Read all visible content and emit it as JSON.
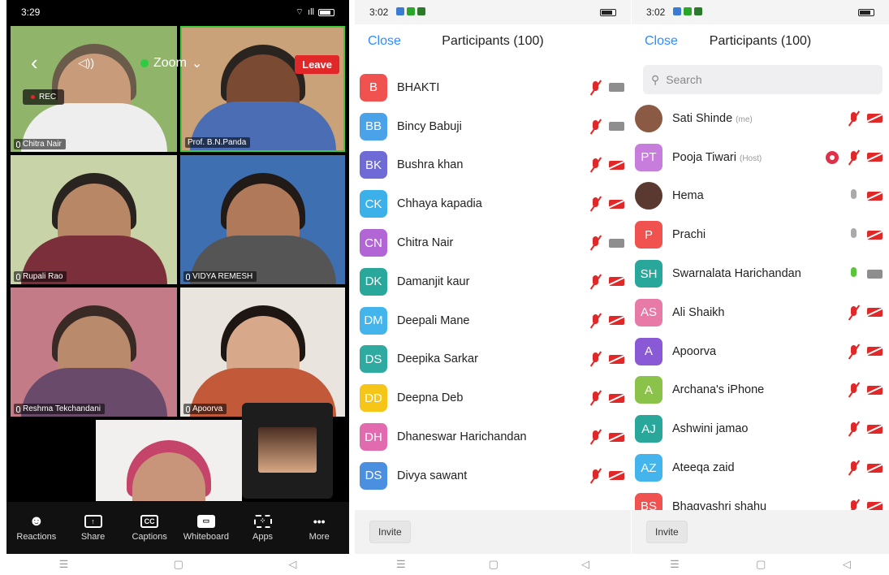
{
  "phone1": {
    "status": {
      "time": "3:29",
      "wifi": "⌔",
      "signal": "ıll"
    },
    "topbar": {
      "back": "‹",
      "speaker": "◁))",
      "title": "Zoom",
      "chevron": "⌄",
      "leave": "Leave"
    },
    "rec": "REC",
    "tiles": [
      {
        "name": "Chitra Nair"
      },
      {
        "name": "Prof. B.N.Panda"
      },
      {
        "name": "Rupali Rao"
      },
      {
        "name": "VIDYA REMESH"
      },
      {
        "name": "Reshma Tekchandani"
      },
      {
        "name": "Apoorva"
      }
    ],
    "toolbar": [
      {
        "label": "Reactions",
        "icon": "☻"
      },
      {
        "label": "Share",
        "icon": "↑"
      },
      {
        "label": "Captions",
        "icon": "CC"
      },
      {
        "label": "Whiteboard",
        "icon": "▭"
      },
      {
        "label": "Apps",
        "icon": "⁘"
      },
      {
        "label": "More",
        "icon": "•••"
      }
    ]
  },
  "phone2": {
    "status": {
      "time": "3:02"
    },
    "header": {
      "close": "Close",
      "title": "Participants (100)"
    },
    "participants": [
      {
        "initials": "B",
        "name": "BHAKTI",
        "color": "#f0524f",
        "mic": "muted",
        "cam": "gray"
      },
      {
        "initials": "BB",
        "name": "Bincy Babuji",
        "color": "#4aa3e8",
        "mic": "muted",
        "cam": "gray"
      },
      {
        "initials": "BK",
        "name": "Bushra khan",
        "color": "#6e6bd6",
        "mic": "muted",
        "cam": "red"
      },
      {
        "initials": "CK",
        "name": "Chhaya kapadia",
        "color": "#3cb0e8",
        "mic": "muted",
        "cam": "red"
      },
      {
        "initials": "CN",
        "name": "Chitra Nair",
        "color": "#b266d6",
        "mic": "muted",
        "cam": "gray"
      },
      {
        "initials": "DK",
        "name": "Damanjit kaur",
        "color": "#2aa79b",
        "mic": "muted",
        "cam": "red"
      },
      {
        "initials": "DM",
        "name": "Deepali Mane",
        "color": "#43b5ec",
        "mic": "muted",
        "cam": "red"
      },
      {
        "initials": "DS",
        "name": "Deepika Sarkar",
        "color": "#2eaaa0",
        "mic": "muted",
        "cam": "red"
      },
      {
        "initials": "DD",
        "name": "Deepna Deb",
        "color": "#f5c518",
        "mic": "muted",
        "cam": "red"
      },
      {
        "initials": "DH",
        "name": "Dhaneswar Harichandan",
        "color": "#e26bb0",
        "mic": "muted",
        "cam": "red"
      },
      {
        "initials": "DS",
        "name": "Divya sawant",
        "color": "#4a8fe0",
        "mic": "muted",
        "cam": "red"
      }
    ],
    "invite": "Invite"
  },
  "phone3": {
    "status": {
      "time": "3:02"
    },
    "header": {
      "close": "Close",
      "title": "Participants (100)"
    },
    "search_placeholder": "Search",
    "participants": [
      {
        "initials": "",
        "name": "Sati Shinde",
        "tag": "(me)",
        "color": "#8a5a44",
        "mic": "muted",
        "cam": "red"
      },
      {
        "initials": "PT",
        "name": "Pooja Tiwari",
        "tag": "(Host)",
        "color": "#c77ddb",
        "mic": "muted",
        "cam": "red",
        "recording": true
      },
      {
        "initials": "",
        "name": "Hema",
        "color": "#5a3a30",
        "mic": "gray",
        "cam": "red"
      },
      {
        "initials": "P",
        "name": "Prachi",
        "color": "#f0524f",
        "mic": "gray",
        "cam": "red"
      },
      {
        "initials": "SH",
        "name": "Swarnalata Harichandan",
        "color": "#2aa79b",
        "mic": "green",
        "cam": "gray"
      },
      {
        "initials": "AS",
        "name": "Ali Shaikh",
        "color": "#e87aa8",
        "mic": "muted",
        "cam": "red"
      },
      {
        "initials": "A",
        "name": "Apoorva",
        "color": "#8a5ad6",
        "mic": "muted",
        "cam": "red"
      },
      {
        "initials": "A",
        "name": "Archana's iPhone",
        "color": "#8bc34a",
        "mic": "muted",
        "cam": "red"
      },
      {
        "initials": "AJ",
        "name": "Ashwini jamao",
        "color": "#2aa79b",
        "mic": "muted",
        "cam": "red"
      },
      {
        "initials": "AZ",
        "name": "Ateeqa zaid",
        "color": "#43b5ec",
        "mic": "muted",
        "cam": "red"
      },
      {
        "initials": "BS",
        "name": "Bhagyashri shahu",
        "color": "#f0524f",
        "mic": "muted",
        "cam": "red"
      }
    ],
    "invite": "Invite"
  },
  "navbar": {
    "menu": "☰",
    "home": "▢",
    "back": "◁"
  }
}
